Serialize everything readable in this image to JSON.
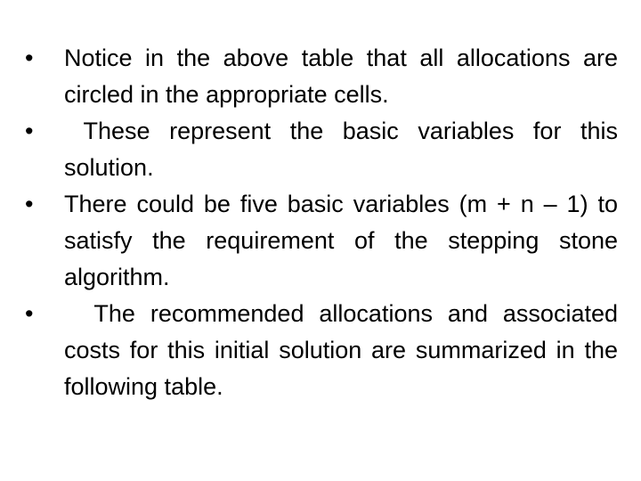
{
  "bullets": [
    {
      "icon": "bullet-dot",
      "glyph": "•",
      "text": "Notice in the above table that all allocations are circled in the appropriate cells."
    },
    {
      "icon": "bullet-dot",
      "glyph": "•",
      "text": " These represent the basic variables for this solution."
    },
    {
      "icon": "bullet-dot",
      "glyph": "•",
      "text": "There could be five basic variables (m + n – 1) to satisfy the requirement of the stepping stone algorithm."
    },
    {
      "icon": "bullet-dot",
      "glyph": "•",
      "text": "  The recommended allocations and associated costs for this initial solution are summarized in the following table."
    }
  ]
}
